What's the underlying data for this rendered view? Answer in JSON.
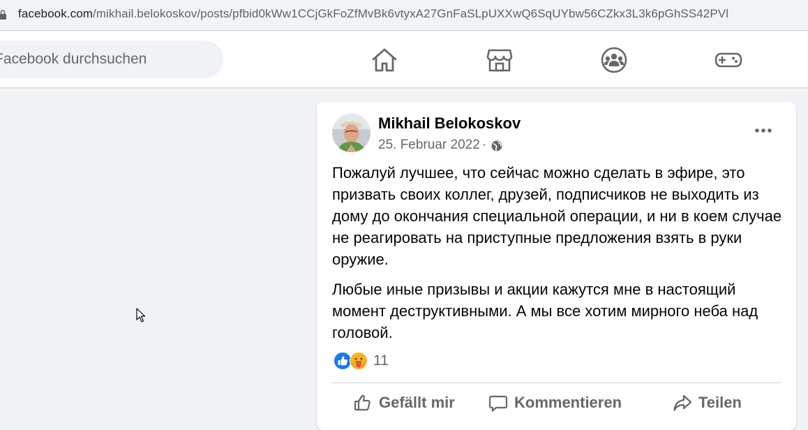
{
  "browser": {
    "url_host": "facebook.com",
    "url_path": "/mikhail.belokoskov/posts/pfbid0kWw1CCjGkFoZfMvBk6vtyxA27GnFaSLpUXXwQ6SqUYbw56CZkx3L3k6pGhSS42PVl",
    "lock_icon": "lock-icon"
  },
  "header": {
    "search_placeholder": "Facebook durchsuchen",
    "nav": [
      {
        "name": "home-icon"
      },
      {
        "name": "marketplace-icon"
      },
      {
        "name": "groups-icon"
      },
      {
        "name": "gaming-icon"
      }
    ]
  },
  "post": {
    "author": "Mikhail Belokoskov",
    "date": "25. Februar 2022",
    "separator": "·",
    "privacy_icon": "globe-icon",
    "paragraphs": [
      "Пожалуй лучшее, что сейчас можно сделать в эфире, это призвать своих коллег, друзей, подписчиков не выходить из дому до окончания специальной операции, и ни в коем случае не реагировать на приступные предложения взять в руки оружие.",
      "Любые иные призывы и акции кажутся мне в настоящий момент деструктивными. А мы все хотим мирного неба над головой."
    ],
    "reactions": {
      "icons": [
        "like-reaction-icon",
        "care-reaction-icon"
      ],
      "count": "11"
    },
    "actions": {
      "like": "Gefällt mir",
      "comment": "Kommentieren",
      "share": "Teilen"
    }
  },
  "colors": {
    "page_bg": "#f0f2f5",
    "card_bg": "#ffffff",
    "text_primary": "#050505",
    "text_secondary": "#65676b",
    "like_blue": "#1877f2",
    "care_yellow": "#f7b125"
  }
}
